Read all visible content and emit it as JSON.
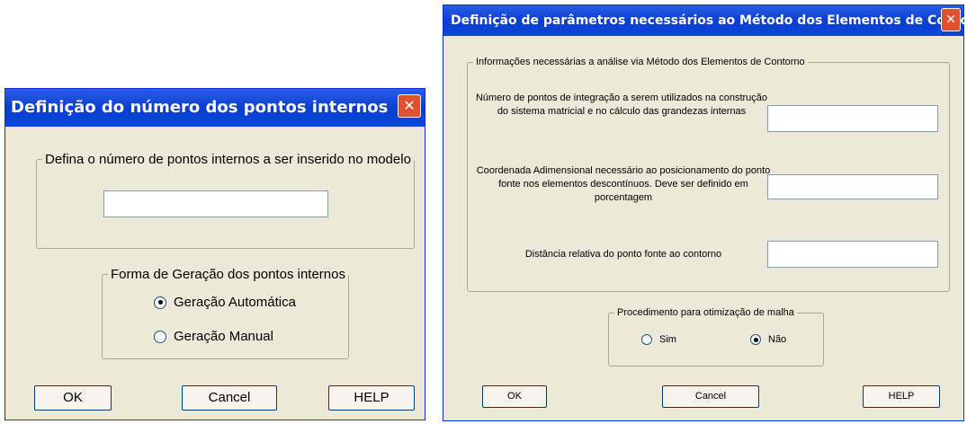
{
  "dialog1": {
    "title": "Definição do número dos pontos internos",
    "close_glyph": "✕",
    "group_points": {
      "legend": "Defina o número de pontos internos a ser inserido no modelo",
      "value": ""
    },
    "group_generation": {
      "legend": "Forma de Geração dos pontos internos",
      "options": [
        {
          "label": "Geração Automática",
          "selected": true
        },
        {
          "label": "Geração Manual",
          "selected": false
        }
      ]
    },
    "buttons": {
      "ok": "OK",
      "cancel": "Cancel",
      "help": "HELP"
    }
  },
  "dialog2": {
    "title": "Definição de parâmetros necessários ao Método dos Elementos de Contorno",
    "close_glyph": "✕",
    "group_info": {
      "legend": "Informações necessárias a análise via Método dos Elementos de Contorno",
      "fields": [
        {
          "label": "Número de pontos de integração a serem utilizados na construção do sistema matricial e no cálculo das grandezas internas",
          "value": ""
        },
        {
          "label": "Coordenada Adimensional necessário ao posicionamento do ponto fonte nos elementos descontínuos. Deve ser definido em porcentagem",
          "value": ""
        },
        {
          "label": "Distância relativa do ponto fonte ao contorno",
          "value": ""
        }
      ]
    },
    "group_mesh": {
      "legend": "Procedimento para otimização de malha",
      "options": [
        {
          "label": "Sim",
          "selected": false
        },
        {
          "label": "Não",
          "selected": true
        }
      ]
    },
    "buttons": {
      "ok": "OK",
      "cancel": "Cancel",
      "help": "HELP"
    }
  }
}
